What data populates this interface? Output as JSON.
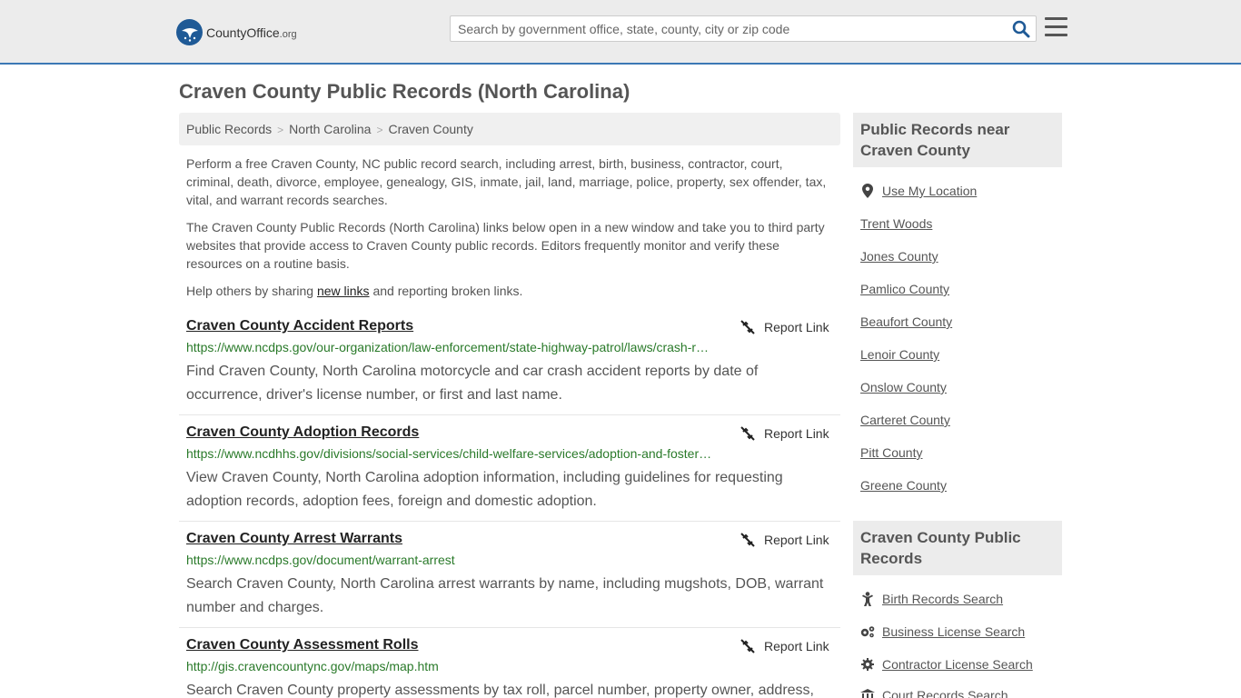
{
  "header": {
    "logo_text": "CountyOffice",
    "logo_tld": ".org",
    "search_placeholder": "Search by government office, state, county, city or zip code"
  },
  "page": {
    "title": "Craven County Public Records (North Carolina)"
  },
  "breadcrumb": [
    "Public Records",
    "North Carolina",
    "Craven County"
  ],
  "intro": {
    "para1": "Perform a free Craven County, NC public record search, including arrest, birth, business, contractor, court, criminal, death, divorce, employee, genealogy, GIS, inmate, jail, land, marriage, police, property, sex offender, tax, vital, and warrant records searches.",
    "para2": "The Craven County Public Records (North Carolina) links below open in a new window and take you to third party websites that provide access to Craven County public records. Editors frequently monitor and verify these resources on a routine basis.",
    "para3_before": "Help others by sharing ",
    "para3_link": "new links",
    "para3_after": " and reporting broken links."
  },
  "report_label": "Report Link",
  "records": [
    {
      "title": "Craven County Accident Reports",
      "url": "https://www.ncdps.gov/our-organization/law-enforcement/state-highway-patrol/laws/crash-reports",
      "desc": "Find Craven County, North Carolina motorcycle and car crash accident reports by date of occurrence, driver's license number, or first and last name."
    },
    {
      "title": "Craven County Adoption Records",
      "url": "https://www.ncdhhs.gov/divisions/social-services/child-welfare-services/adoption-and-foster-care",
      "desc": "View Craven County, North Carolina adoption information, including guidelines for requesting adoption records, adoption fees, foreign and domestic adoption."
    },
    {
      "title": "Craven County Arrest Warrants",
      "url": "https://www.ncdps.gov/document/warrant-arrest",
      "desc": "Search Craven County, North Carolina arrest warrants by name, including mugshots, DOB, warrant number and charges."
    },
    {
      "title": "Craven County Assessment Rolls",
      "url": "http://gis.cravencountync.gov/maps/map.htm",
      "desc": "Search Craven County property assessments by tax roll, parcel number, property owner, address,"
    }
  ],
  "sidebar": {
    "nearby_heading": "Public Records near Craven County",
    "use_location": "Use My Location",
    "nearby": [
      "Trent Woods",
      "Jones County",
      "Pamlico County",
      "Beaufort County",
      "Lenoir County",
      "Onslow County",
      "Carteret County",
      "Pitt County",
      "Greene County"
    ],
    "records_heading": "Craven County Public Records",
    "record_links": [
      {
        "label": "Birth Records Search",
        "icon": "baby-icon"
      },
      {
        "label": "Business License Search",
        "icon": "gears-icon"
      },
      {
        "label": "Contractor License Search",
        "icon": "gear-icon"
      },
      {
        "label": "Court Records Search",
        "icon": "courthouse-icon"
      }
    ]
  },
  "colors": {
    "accent": "#3c78b5",
    "url_green": "#2a7a2a",
    "logo_blue": "#1f5a96"
  }
}
